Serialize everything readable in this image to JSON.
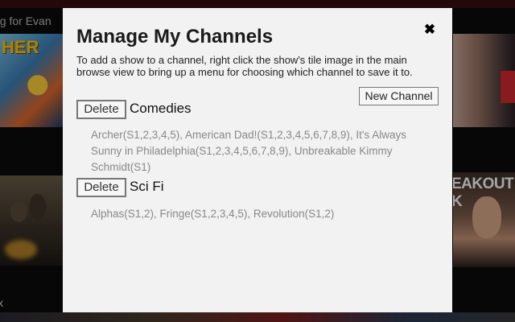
{
  "background": {
    "row_title": "ng for Evan",
    "footer_text": "ix",
    "tile_left_top_text": "HER",
    "tile_right_text": "EAKOUT K"
  },
  "modal": {
    "title": "Manage My Channels",
    "close_label": "✖",
    "description": "To add a show to a channel, right click the show's tile image in the main browse view to bring up a menu for choosing which channel to save it to.",
    "new_channel_label": "New Channel",
    "delete_label": "Delete",
    "channels": [
      {
        "name": "Comedies",
        "shows": "Archer(S1,2,3,4,5), American Dad!(S1,2,3,4,5,6,7,8,9), It's Always Sunny in Philadelphia(S1,2,3,4,5,6,7,8,9), Unbreakable Kimmy Schmidt(S1)"
      },
      {
        "name": "Sci Fi",
        "shows": "Alphas(S1,2), Fringe(S1,2,3,4,5), Revolution(S1,2)"
      }
    ]
  },
  "colors": {
    "modal_background": "#f2f2f2",
    "show_text": "#888888",
    "accent_red": "#d3292f"
  }
}
